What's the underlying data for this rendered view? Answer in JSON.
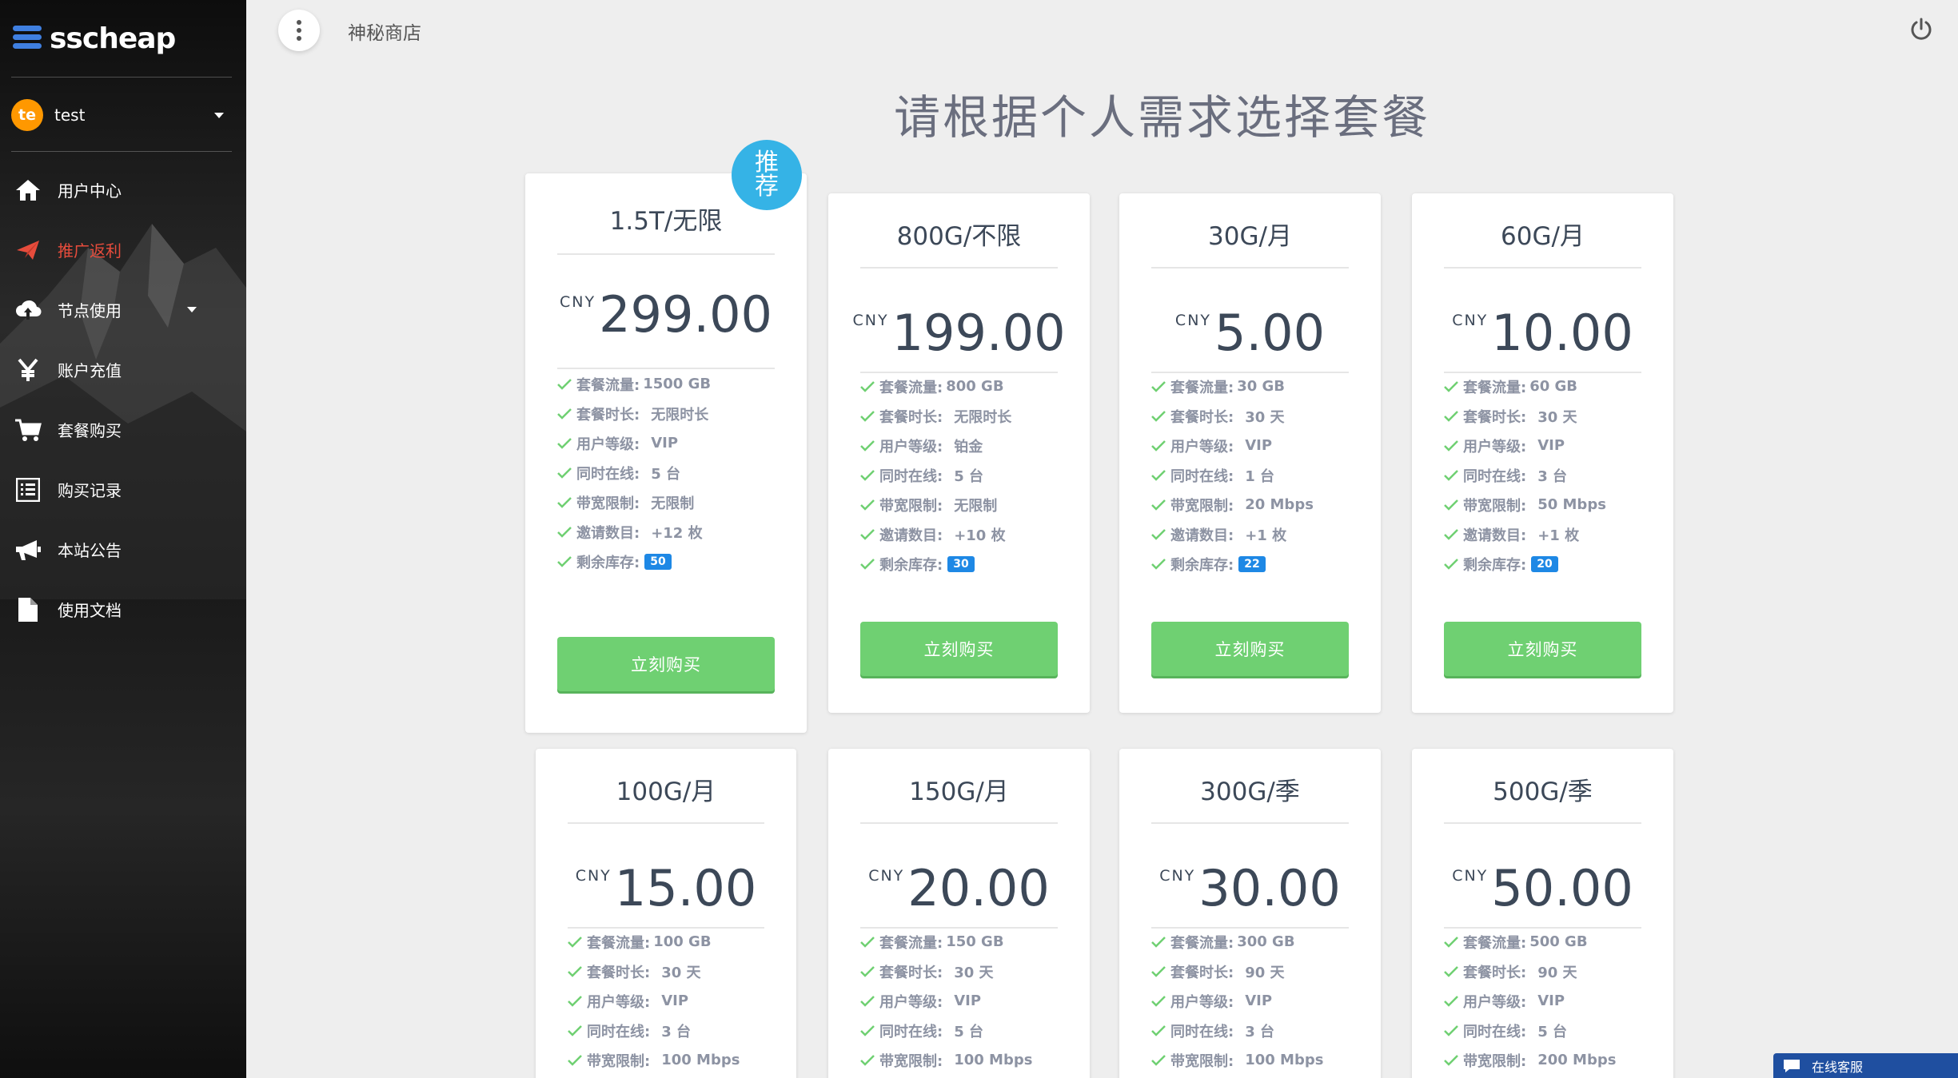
{
  "app": {
    "logo_text": "sscheap",
    "page_title": "神秘商店"
  },
  "user": {
    "avatar_initials": "te",
    "name": "test"
  },
  "sidebar": {
    "items": [
      {
        "label": "用户中心",
        "icon": "home-icon",
        "active": false
      },
      {
        "label": "推广返利",
        "icon": "send-icon",
        "active": true
      },
      {
        "label": "节点使用",
        "icon": "cloud-upload-icon",
        "active": false,
        "expandable": true
      },
      {
        "label": "账户充值",
        "icon": "yen-icon",
        "active": false
      },
      {
        "label": "套餐购买",
        "icon": "cart-icon",
        "active": false
      },
      {
        "label": "购买记录",
        "icon": "list-icon",
        "active": false
      },
      {
        "label": "本站公告",
        "icon": "megaphone-icon",
        "active": false
      },
      {
        "label": "使用文档",
        "icon": "document-icon",
        "active": false
      }
    ]
  },
  "main": {
    "heading": "请根据个人需求选择套餐",
    "recommend_badge": [
      "推",
      "荐"
    ],
    "buy_label": "立刻购买",
    "currency": "CNY",
    "feature_labels": {
      "traffic": "套餐流量:",
      "duration": "套餐时长:",
      "level": "用户等级:",
      "online": "同时在线:",
      "bandwidth": "带宽限制:",
      "invites": "邀请数目:",
      "stock": "剩余库存:"
    },
    "plans": [
      {
        "name": "1.5T/无限",
        "price": "299.00",
        "traffic": "1500 GB",
        "duration": "无限时长",
        "level": "VIP",
        "online": "5 台",
        "bandwidth": "无限制",
        "invites": "+12 枚",
        "stock": "50"
      },
      {
        "name": "800G/不限",
        "price": "199.00",
        "traffic": "800 GB",
        "duration": "无限时长",
        "level": "铂金",
        "online": "5 台",
        "bandwidth": "无限制",
        "invites": "+10 枚",
        "stock": "30"
      },
      {
        "name": "30G/月",
        "price": "5.00",
        "traffic": "30 GB",
        "duration": "30 天",
        "level": "VIP",
        "online": "1 台",
        "bandwidth": "20 Mbps",
        "invites": "+1 枚",
        "stock": "22"
      },
      {
        "name": "60G/月",
        "price": "10.00",
        "traffic": "60 GB",
        "duration": "30 天",
        "level": "VIP",
        "online": "3 台",
        "bandwidth": "50 Mbps",
        "invites": "+1 枚",
        "stock": "20"
      },
      {
        "name": "100G/月",
        "price": "15.00",
        "traffic": "100 GB",
        "duration": "30 天",
        "level": "VIP",
        "online": "3 台",
        "bandwidth": "100 Mbps"
      },
      {
        "name": "150G/月",
        "price": "20.00",
        "traffic": "150 GB",
        "duration": "30 天",
        "level": "VIP",
        "online": "5 台",
        "bandwidth": "100 Mbps"
      },
      {
        "name": "300G/季",
        "price": "30.00",
        "traffic": "300 GB",
        "duration": "90 天",
        "level": "VIP",
        "online": "3 台",
        "bandwidth": "100 Mbps"
      },
      {
        "name": "500G/季",
        "price": "50.00",
        "traffic": "500 GB",
        "duration": "90 天",
        "level": "VIP",
        "online": "5 台",
        "bandwidth": "200 Mbps"
      }
    ]
  },
  "chat_widget": {
    "label": "在线客服"
  },
  "colors": {
    "accent_active": "#e74c3c",
    "buy_button": "#6fd072",
    "stock_badge": "#1e88e5",
    "recommend_badge": "#35b3e6",
    "avatar": "#ff9800"
  }
}
